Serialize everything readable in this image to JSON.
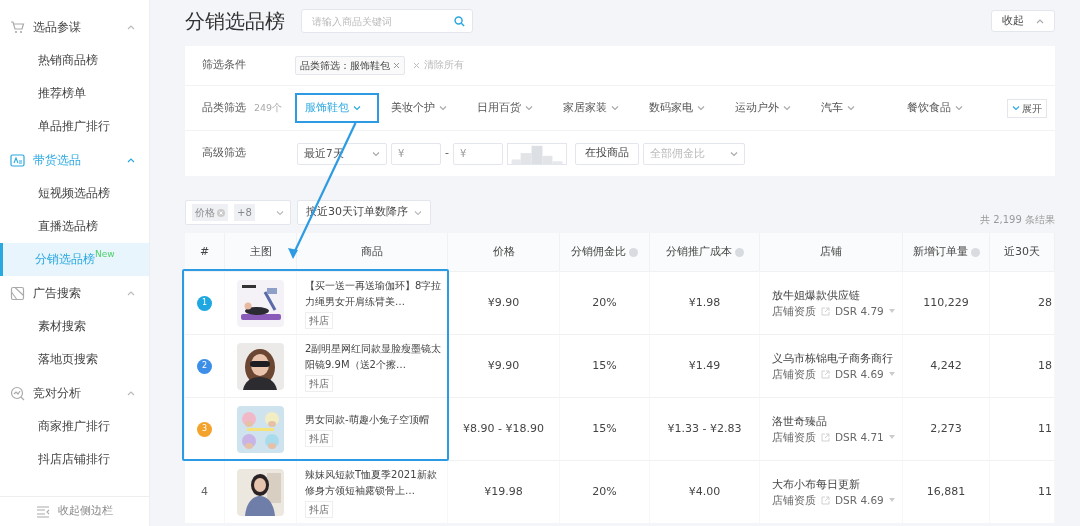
{
  "sidebar": {
    "groups": [
      {
        "label": "选品参谋",
        "active": false,
        "expanded": true,
        "items": [
          {
            "label": "热销商品榜",
            "selected": false
          },
          {
            "label": "推荐榜单",
            "selected": false
          },
          {
            "label": "单品推广排行",
            "selected": false
          }
        ]
      },
      {
        "label": "带货选品",
        "active": true,
        "expanded": true,
        "items": [
          {
            "label": "短视频选品榜",
            "selected": false
          },
          {
            "label": "直播选品榜",
            "selected": false
          },
          {
            "label": "分销选品榜",
            "selected": true,
            "badge": "New"
          }
        ]
      },
      {
        "label": "广告搜索",
        "active": false,
        "expanded": true,
        "items": [
          {
            "label": "素材搜索",
            "selected": false
          },
          {
            "label": "落地页搜索",
            "selected": false
          }
        ]
      },
      {
        "label": "竞对分析",
        "active": false,
        "expanded": true,
        "items": [
          {
            "label": "商家推广排行",
            "selected": false
          },
          {
            "label": "抖店店铺排行",
            "selected": false
          }
        ]
      }
    ],
    "collapse": "收起侧边栏"
  },
  "page_title": "分销选品榜",
  "search": {
    "placeholder": "请输入商品关键词"
  },
  "collapse_button": "收起",
  "filters": {
    "conditions": {
      "label": "筛选条件",
      "tags": [
        "品类筛选：服饰鞋包"
      ],
      "clear": "清除所有"
    },
    "category": {
      "label": "品类筛选",
      "count": "249个",
      "expand": "展开",
      "options": [
        {
          "label": "服饰鞋包",
          "selected": true
        },
        {
          "label": "美妆个护",
          "selected": false
        },
        {
          "label": "日用百货",
          "selected": false
        },
        {
          "label": "家居家装",
          "selected": false
        },
        {
          "label": "数码家电",
          "selected": false
        },
        {
          "label": "运动户外",
          "selected": false
        },
        {
          "label": "汽车",
          "selected": false
        },
        {
          "label": "餐饮食品",
          "selected": false
        }
      ]
    },
    "advanced": {
      "label": "高级筛选",
      "period": "最近7天",
      "price_min": {
        "placeholder": "¥"
      },
      "separator": "-",
      "price_max": {
        "placeholder": "¥"
      },
      "status": "在投商品",
      "commission": {
        "placeholder": "全部佣金比"
      }
    }
  },
  "toolbar": {
    "tag": "价格",
    "more": "+8",
    "sort": "按近30天订单数降序",
    "total": "共 2,199 条结果"
  },
  "table": {
    "columns": [
      {
        "label": "#",
        "info": false
      },
      {
        "label": "主图",
        "info": false
      },
      {
        "label": "商品",
        "info": false
      },
      {
        "label": "价格",
        "info": false
      },
      {
        "label": "分销佣金比",
        "info": true
      },
      {
        "label": "分销推广成本",
        "info": true
      },
      {
        "label": "店铺",
        "info": false
      },
      {
        "label": "新增订单量",
        "info": true
      },
      {
        "label": "近30天",
        "info": false
      }
    ],
    "rows": [
      {
        "rank": "1",
        "color": "#1ea7e1",
        "highlighted": true,
        "title": "【买一送一再送瑜伽环】8字拉力绳男女开肩练臂美…",
        "platform": "抖店",
        "price": "¥9.90",
        "commission": "20%",
        "cost": "¥1.98",
        "shop": "放牛姐爆款供应链",
        "shop_label": "店铺资质",
        "dsr": "DSR 4.79",
        "orders": "110,229",
        "column_9": "28"
      },
      {
        "rank": "2",
        "color": "#3d8ee8",
        "highlighted": true,
        "title": "2副明星网红同款显脸瘦墨镜太阳镜9.9M（送2个擦…",
        "platform": "抖店",
        "price": "¥9.90",
        "commission": "15%",
        "cost": "¥1.49",
        "shop": "义乌市栋锦电子商务商行",
        "shop_label": "店铺资质",
        "dsr": "DSR 4.69",
        "orders": "4,242",
        "column_9": "18"
      },
      {
        "rank": "3",
        "color": "#f3a22c",
        "highlighted": true,
        "title": "男女同款-萌趣小兔子空顶帽",
        "platform": "抖店",
        "price": "¥8.90 - ¥18.90",
        "commission": "15%",
        "cost": "¥1.33 - ¥2.83",
        "shop": "洛世奇臻品",
        "shop_label": "店铺资质",
        "dsr": "DSR 4.71",
        "orders": "2,273",
        "column_9": "11"
      },
      {
        "rank": "4",
        "highlighted": false,
        "title": "辣妹风短款T恤夏季2021新款修身方领短袖露锁骨上…",
        "platform": "抖店",
        "price": "¥19.98",
        "commission": "20%",
        "cost": "¥4.00",
        "shop": "大布小布每日更新",
        "shop_label": "店铺资质",
        "dsr": "DSR 4.69",
        "orders": "16,881",
        "column_9": "11"
      }
    ]
  }
}
